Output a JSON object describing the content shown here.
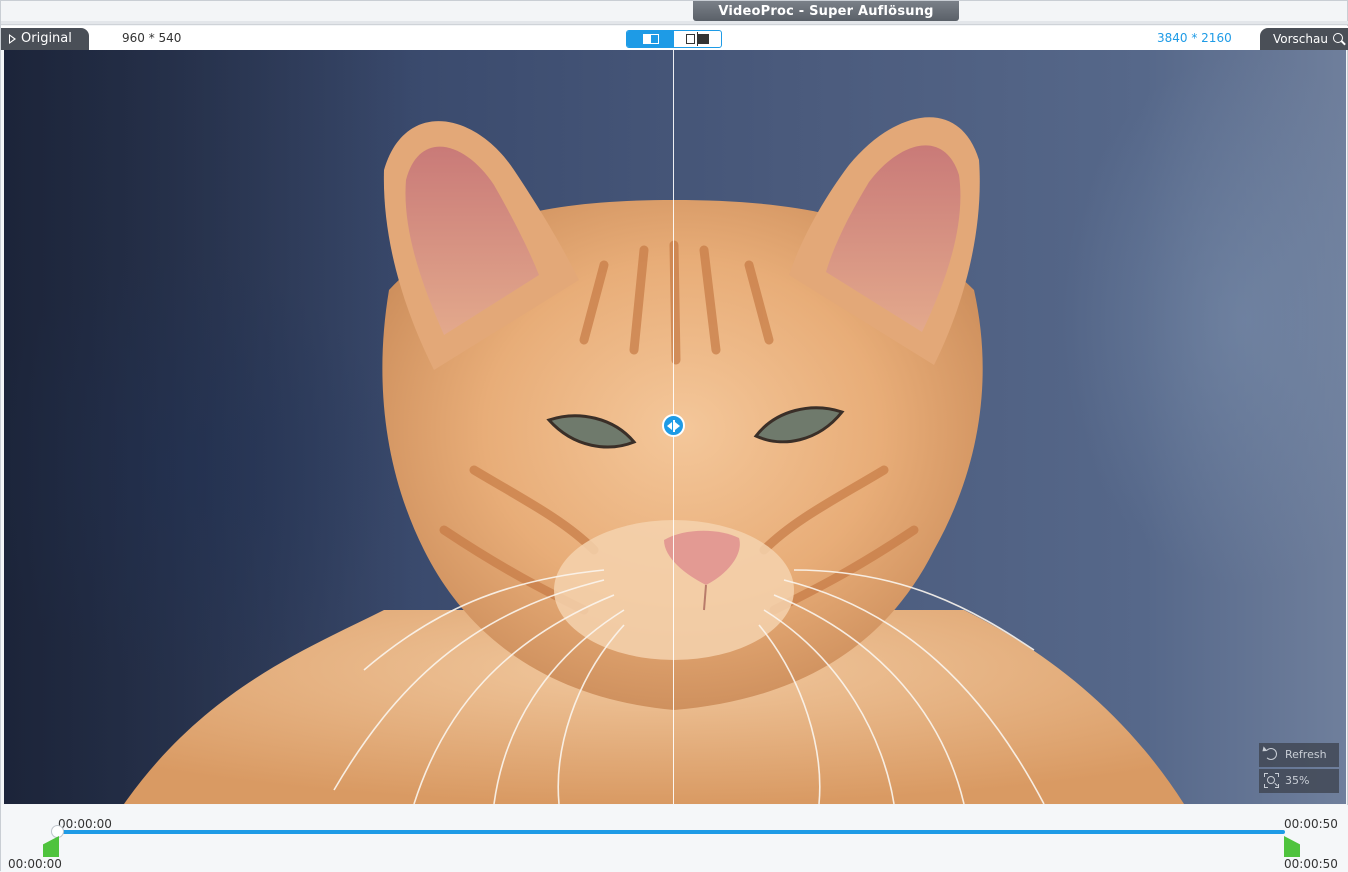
{
  "window": {
    "title": "VideoProc - Super Auflösung"
  },
  "header": {
    "original_label": "Original",
    "original_resolution": "960 * 540",
    "output_resolution": "3840 * 2160",
    "preview_label": "Vorschau",
    "view_modes": [
      "split-view-icon",
      "side-by-side-icon"
    ],
    "active_view_mode": "split-view-icon"
  },
  "viewer": {
    "controls": {
      "refresh_label": "Refresh",
      "zoom_label": "35%"
    }
  },
  "timeline": {
    "current_time": "00:00:00",
    "end_time_top": "00:00:50",
    "start_time": "00:00:00",
    "end_time_bottom": "00:00:50",
    "progress": 0.0
  },
  "colors": {
    "accent": "#1e9be6",
    "marker": "#4fc33d",
    "tab_dark": "#4a4f57"
  }
}
